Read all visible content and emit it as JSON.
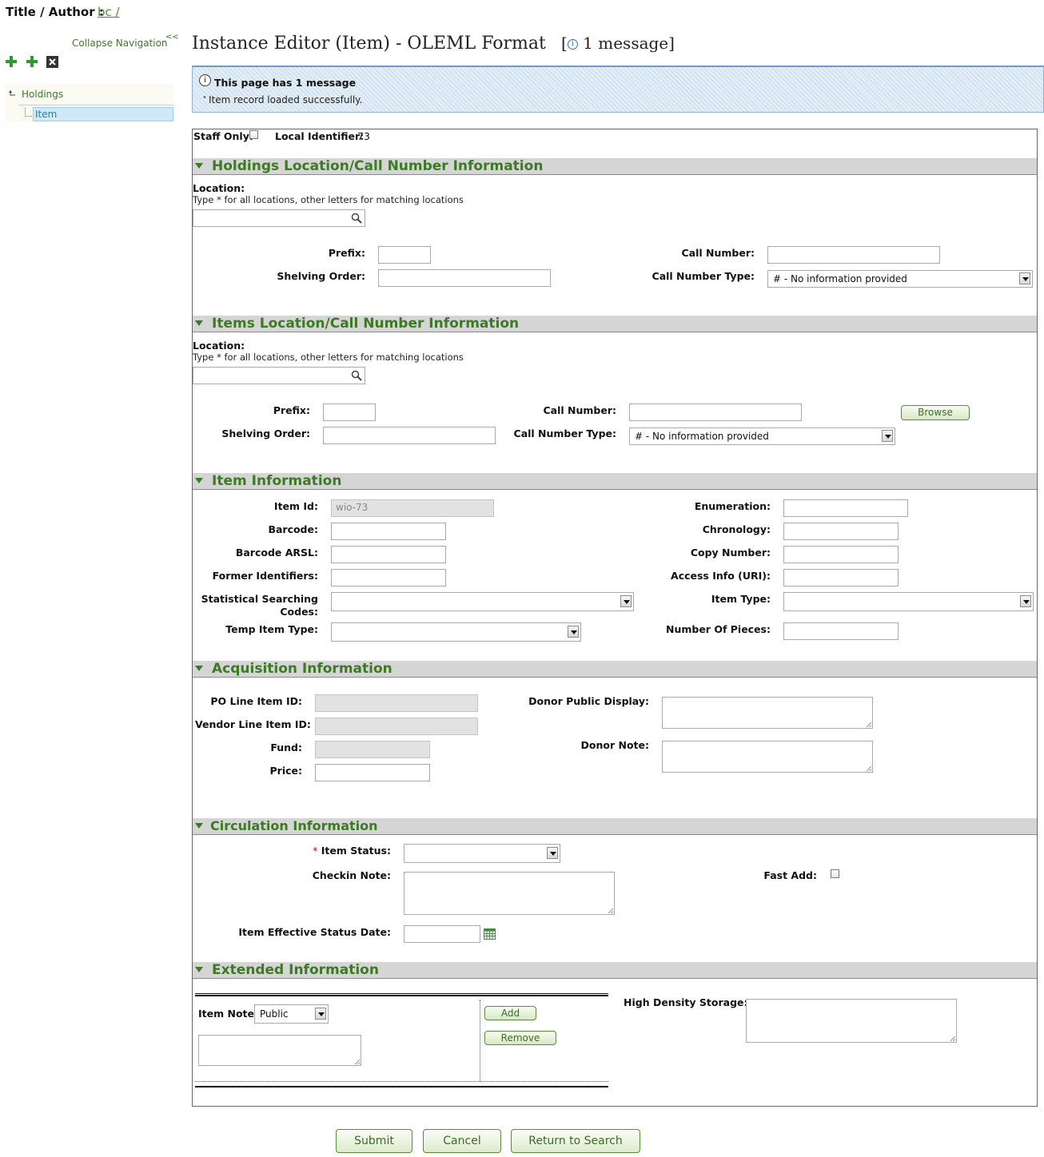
{
  "header": {
    "title_author_label": "Title / Author :",
    "title_author_link": "bc /"
  },
  "nav": {
    "collapse_label": "Collapse Navigation",
    "collapse_chevron": "<<",
    "tree": [
      {
        "label": "Holdings"
      },
      {
        "label": "Item"
      }
    ]
  },
  "page": {
    "title": "Instance Editor (Item) - OLEML Format",
    "message_link": "1 message"
  },
  "message_box": {
    "heading": "This page has 1 message",
    "items": [
      "Item record loaded successfully."
    ]
  },
  "top_row": {
    "staff_only_label": "Staff Only:",
    "local_id_label": "Local Identifier:",
    "local_id_value": "73"
  },
  "holdings_section": {
    "title": "Holdings Location/Call Number Information",
    "location_label": "Location:",
    "location_hint": "Type * for all locations, other letters for matching locations",
    "location_value": "",
    "prefix_label": "Prefix:",
    "shelving_order_label": "Shelving Order:",
    "call_number_label": "Call Number:",
    "call_number_type_label": "Call Number Type:",
    "call_number_type_value": "# - No information provided"
  },
  "items_section": {
    "title": "Items Location/Call Number Information",
    "location_label": "Location:",
    "location_hint": "Type * for all locations, other letters for matching locations",
    "prefix_label": "Prefix:",
    "shelving_order_label": "Shelving Order:",
    "call_number_label": "Call Number:",
    "call_number_type_label": "Call Number Type:",
    "call_number_type_value": "# - No information provided",
    "browse_label": "Browse"
  },
  "item_info": {
    "title": "Item Information",
    "item_id_label": "Item Id:",
    "item_id_value": "wio-73",
    "barcode_label": "Barcode:",
    "barcode_arsl_label": "Barcode ARSL:",
    "former_ids_label": "Former Identifiers:",
    "stat_codes_label_1": "Statistical Searching",
    "stat_codes_label_2": "Codes:",
    "temp_item_type_label": "Temp Item Type:",
    "enumeration_label": "Enumeration:",
    "chronology_label": "Chronology:",
    "copy_number_label": "Copy Number:",
    "access_info_label": "Access Info (URI):",
    "item_type_label": "Item Type:",
    "number_of_pieces_label": "Number Of Pieces:"
  },
  "acquisition": {
    "title": "Acquisition Information",
    "po_line_label": "PO Line Item ID:",
    "vendor_line_label": "Vendor Line Item ID:",
    "fund_label": "Fund:",
    "price_label": "Price:",
    "donor_public_label": "Donor Public Display:",
    "donor_note_label": "Donor Note:"
  },
  "circulation": {
    "title": "Circulation Information",
    "required_mark": "*",
    "item_status_label": "Item Status:",
    "checkin_note_label": "Checkin Note:",
    "effective_date_label": "Item Effective Status Date:",
    "fast_add_label": "Fast Add:"
  },
  "extended": {
    "title": "Extended Information",
    "item_note_label": "Item Note:",
    "item_note_type": "Public",
    "add_label": "Add",
    "remove_label": "Remove",
    "high_density_label": "High Density Storage:"
  },
  "footer": {
    "submit": "Submit",
    "cancel": "Cancel",
    "return": "Return to Search"
  },
  "colors": {
    "accent_green": "#3d7a24",
    "message_bg": "#d6e4f1",
    "selected_tree": "#cfeaf7"
  }
}
